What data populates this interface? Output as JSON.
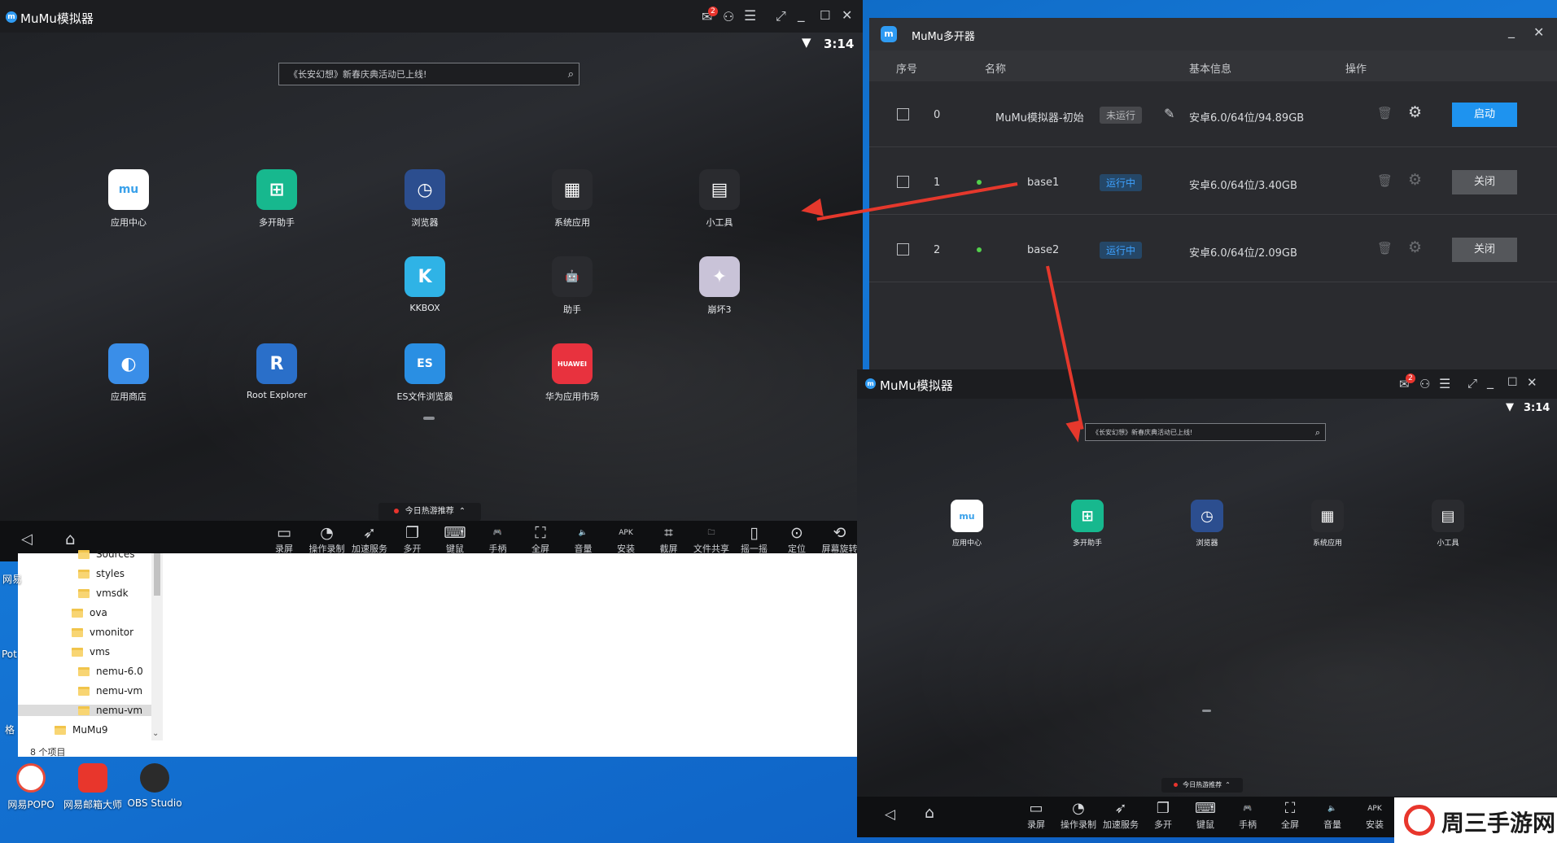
{
  "emulator_main": {
    "title": "MuMu模拟器",
    "badge": "2",
    "time": "3:14",
    "search_placeholder": "《长安幻想》新春庆典活动已上线!",
    "apps": [
      {
        "label": "应用中心",
        "icon": "app-center-icon",
        "color": "#ffffff",
        "glyph": "mu"
      },
      {
        "label": "多开助手",
        "icon": "multi-open-icon",
        "color": "#17b88e",
        "glyph": "⊞"
      },
      {
        "label": "浏览器",
        "icon": "browser-compass-icon",
        "color": "#2c4e8f",
        "glyph": "◷"
      },
      {
        "label": "系统应用",
        "icon": "system-apps-icon",
        "color": "#2a2b2f",
        "glyph": "▦"
      },
      {
        "label": "小工具",
        "icon": "tools-icon",
        "color": "#2a2b2f",
        "glyph": "▤"
      },
      {
        "label": "KKBOX",
        "icon": "kkbox-icon",
        "color": "#2fb3e6",
        "glyph": "K"
      },
      {
        "label": "助手",
        "icon": "android-icon",
        "color": "#2a2b2f",
        "glyph": "🤖"
      },
      {
        "label": "崩坏3",
        "icon": "honkai-icon",
        "color": "#c9c3d8",
        "glyph": "✦"
      },
      {
        "label": "应用商店",
        "icon": "app-store-icon",
        "color": "#3a8ee8",
        "glyph": "◐"
      },
      {
        "label": "Root Explorer",
        "icon": "root-explorer-icon",
        "color": "#2a6fc9",
        "glyph": "R"
      },
      {
        "label": "ES文件浏览器",
        "icon": "es-file-icon",
        "color": "#2a8fe3",
        "glyph": "ES"
      },
      {
        "label": "华为应用市场",
        "icon": "huawei-icon",
        "color": "#e8323e",
        "glyph": "HUAWEI"
      }
    ],
    "hot_label": "今日热游推荐",
    "tools": [
      {
        "label": "录屏",
        "icon": "record-screen-icon",
        "glyph": "▭"
      },
      {
        "label": "操作录制",
        "icon": "macro-record-icon",
        "glyph": "◔"
      },
      {
        "label": "加速服务",
        "icon": "rocket-icon",
        "glyph": "➶"
      },
      {
        "label": "多开",
        "icon": "multi-instance-icon",
        "glyph": "❐"
      },
      {
        "label": "键鼠",
        "icon": "keyboard-icon",
        "glyph": "⌨"
      },
      {
        "label": "手柄",
        "icon": "gamepad-icon",
        "glyph": "🎮"
      },
      {
        "label": "全屏",
        "icon": "fullscreen-icon",
        "glyph": "⛶"
      },
      {
        "label": "音量",
        "icon": "volume-icon",
        "glyph": "🔈"
      },
      {
        "label": "安装",
        "icon": "apk-install-icon",
        "glyph": "APK"
      },
      {
        "label": "截屏",
        "icon": "screenshot-crop-icon",
        "glyph": "⌗"
      },
      {
        "label": "文件共享",
        "icon": "folder-share-icon",
        "glyph": "🗀"
      },
      {
        "label": "摇一摇",
        "icon": "shake-icon",
        "glyph": "▯"
      },
      {
        "label": "定位",
        "icon": "location-pin-icon",
        "glyph": "⊙"
      },
      {
        "label": "屏幕旋转",
        "icon": "rotate-screen-icon",
        "glyph": "⟲"
      }
    ]
  },
  "manager": {
    "title": "MuMu多开器",
    "headers": [
      "序号",
      "名称",
      "基本信息",
      "操作"
    ],
    "rows": [
      {
        "index": "0",
        "name": "MuMu模拟器-初始",
        "status": "未运行",
        "info": "安卓6.0/64位/94.89GB",
        "action": "启动"
      },
      {
        "index": "1",
        "name": "base1",
        "status": "运行中",
        "info": "安卓6.0/64位/3.40GB",
        "action": "关闭"
      },
      {
        "index": "2",
        "name": "base2",
        "status": "运行中",
        "info": "安卓6.0/64位/2.09GB",
        "action": "关闭"
      }
    ]
  },
  "emulator_second": {
    "title": "MuMu模拟器",
    "badge": "2",
    "time": "3:14",
    "search_placeholder": "《长安幻想》新春庆典活动已上线!",
    "apps": [
      {
        "label": "应用中心",
        "icon": "app-center-icon",
        "color": "#ffffff",
        "glyph": "mu"
      },
      {
        "label": "多开助手",
        "icon": "multi-open-icon",
        "color": "#17b88e",
        "glyph": "⊞"
      },
      {
        "label": "浏览器",
        "icon": "browser-compass-icon",
        "color": "#2c4e8f",
        "glyph": "◷"
      },
      {
        "label": "系统应用",
        "icon": "system-apps-icon",
        "color": "#2a2b2f",
        "glyph": "▦"
      },
      {
        "label": "小工具",
        "icon": "tools-icon",
        "color": "#2a2b2f",
        "glyph": "▤"
      }
    ],
    "hot_label": "今日热游推荐",
    "tools": [
      {
        "label": "录屏",
        "icon": "record-screen-icon",
        "glyph": "▭"
      },
      {
        "label": "操作录制",
        "icon": "macro-record-icon",
        "glyph": "◔"
      },
      {
        "label": "加速服务",
        "icon": "rocket-icon",
        "glyph": "➶"
      },
      {
        "label": "多开",
        "icon": "multi-instance-icon",
        "glyph": "❐"
      },
      {
        "label": "键鼠",
        "icon": "keyboard-icon",
        "glyph": "⌨"
      },
      {
        "label": "手柄",
        "icon": "gamepad-icon",
        "glyph": "🎮"
      },
      {
        "label": "全屏",
        "icon": "fullscreen-icon",
        "glyph": "⛶"
      },
      {
        "label": "音量",
        "icon": "volume-icon",
        "glyph": "🔈"
      },
      {
        "label": "安装",
        "icon": "apk-install-icon",
        "glyph": "APK"
      }
    ]
  },
  "explorer": {
    "items": [
      {
        "label": "Sources",
        "level": 2
      },
      {
        "label": "styles",
        "level": 2
      },
      {
        "label": "vmsdk",
        "level": 2
      },
      {
        "label": "ova",
        "level": 1
      },
      {
        "label": "vmonitor",
        "level": 1
      },
      {
        "label": "vms",
        "level": 1
      },
      {
        "label": "nemu-6.0",
        "level": 2
      },
      {
        "label": "nemu-vm",
        "level": 2
      },
      {
        "label": "nemu-vm",
        "level": 2
      },
      {
        "label": "MuMu9",
        "level": 0
      }
    ],
    "status": "8 个项目"
  },
  "desktop": {
    "icons": [
      {
        "label": "网易POPO",
        "icon": "popo-icon",
        "color": "#ffffff"
      },
      {
        "label": "网易邮箱大师",
        "icon": "mail-master-icon",
        "color": "#e8362c"
      },
      {
        "label": "OBS Studio",
        "icon": "obs-icon",
        "color": "#2b2b2b"
      }
    ],
    "edge_labels": [
      "网易",
      "Pot",
      "格"
    ]
  },
  "watermark": {
    "text": "周三手游网"
  }
}
